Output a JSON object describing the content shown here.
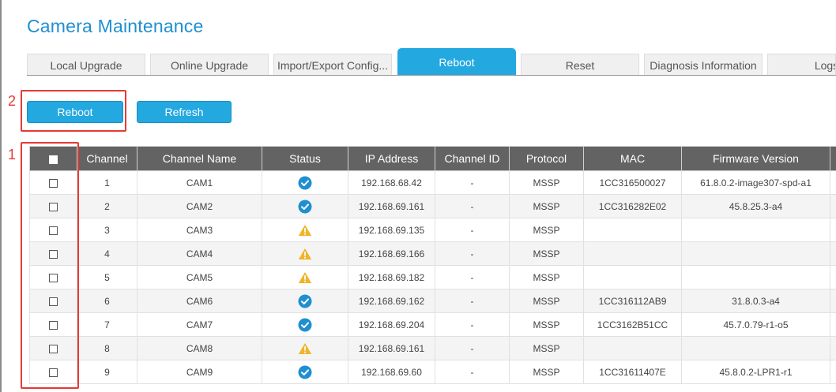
{
  "page": {
    "title": "Camera Maintenance"
  },
  "tabs": [
    {
      "label": "Local Upgrade",
      "active": false
    },
    {
      "label": "Online Upgrade",
      "active": false
    },
    {
      "label": "Import/Export Config...",
      "active": false
    },
    {
      "label": "Reboot",
      "active": true
    },
    {
      "label": "Reset",
      "active": false
    },
    {
      "label": "Diagnosis Information",
      "active": false
    },
    {
      "label": "Logs",
      "active": false
    }
  ],
  "toolbar": {
    "reboot_label": "Reboot",
    "refresh_label": "Refresh"
  },
  "annotations": {
    "callout_1": "1",
    "callout_2": "2"
  },
  "table": {
    "columns": [
      "",
      "Channel",
      "Channel Name",
      "Status",
      "IP Address",
      "Channel ID",
      "Protocol",
      "MAC",
      "Firmware Version"
    ],
    "rows": [
      {
        "channel": "1",
        "name": "CAM1",
        "status": "ok",
        "ip": "192.168.68.42",
        "channel_id": "-",
        "protocol": "MSSP",
        "mac": "1CC316500027",
        "firmware": "61.8.0.2-image307-spd-a1"
      },
      {
        "channel": "2",
        "name": "CAM2",
        "status": "ok",
        "ip": "192.168.69.161",
        "channel_id": "-",
        "protocol": "MSSP",
        "mac": "1CC316282E02",
        "firmware": "45.8.25.3-a4"
      },
      {
        "channel": "3",
        "name": "CAM3",
        "status": "warning",
        "ip": "192.168.69.135",
        "channel_id": "-",
        "protocol": "MSSP",
        "mac": "",
        "firmware": ""
      },
      {
        "channel": "4",
        "name": "CAM4",
        "status": "warning",
        "ip": "192.168.69.166",
        "channel_id": "-",
        "protocol": "MSSP",
        "mac": "",
        "firmware": ""
      },
      {
        "channel": "5",
        "name": "CAM5",
        "status": "warning",
        "ip": "192.168.69.182",
        "channel_id": "-",
        "protocol": "MSSP",
        "mac": "",
        "firmware": ""
      },
      {
        "channel": "6",
        "name": "CAM6",
        "status": "ok",
        "ip": "192.168.69.162",
        "channel_id": "-",
        "protocol": "MSSP",
        "mac": "1CC316112AB9",
        "firmware": "31.8.0.3-a4"
      },
      {
        "channel": "7",
        "name": "CAM7",
        "status": "ok",
        "ip": "192.168.69.204",
        "channel_id": "-",
        "protocol": "MSSP",
        "mac": "1CC3162B51CC",
        "firmware": "45.7.0.79-r1-o5"
      },
      {
        "channel": "8",
        "name": "CAM8",
        "status": "warning",
        "ip": "192.168.69.161",
        "channel_id": "-",
        "protocol": "MSSP",
        "mac": "",
        "firmware": ""
      },
      {
        "channel": "9",
        "name": "CAM9",
        "status": "ok",
        "ip": "192.168.69.60",
        "channel_id": "-",
        "protocol": "MSSP",
        "mac": "1CC31611407E",
        "firmware": "45.8.0.2-LPR1-r1"
      }
    ]
  },
  "colors": {
    "accent": "#23a8e0",
    "ok": "#1f8fd0",
    "warning": "#f0b429",
    "callout": "#e53935"
  }
}
